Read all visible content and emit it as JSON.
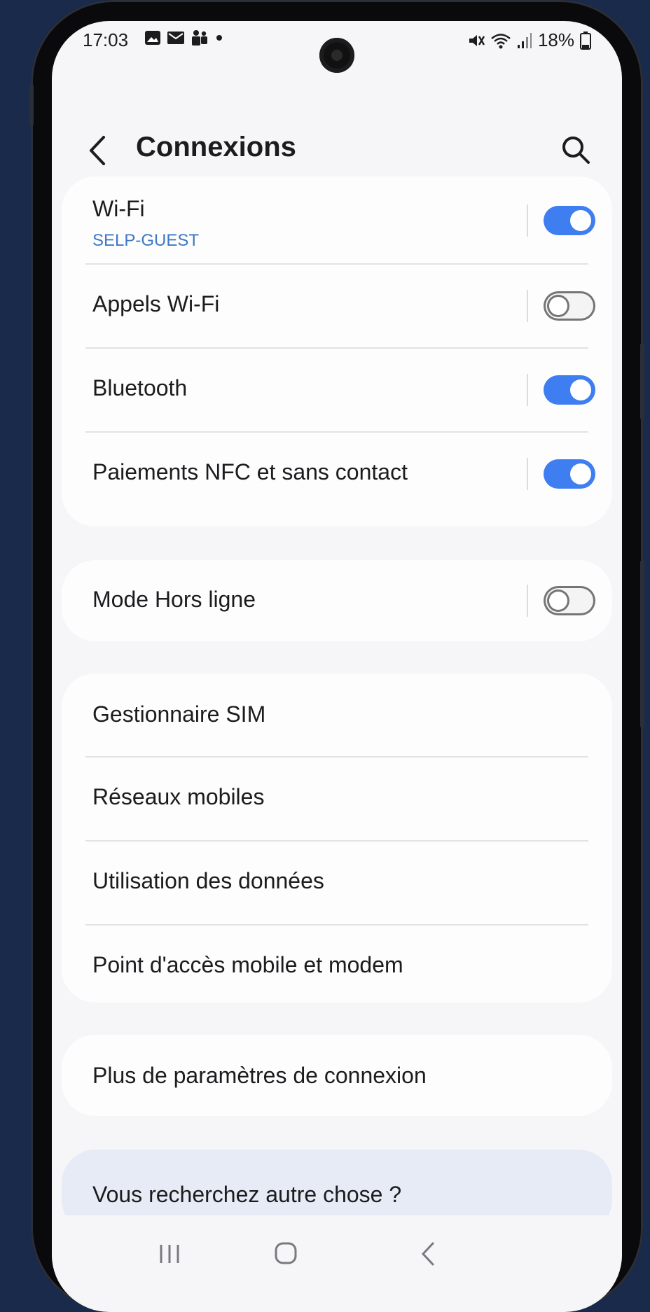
{
  "status": {
    "time": "17:03",
    "battery": "18%",
    "left_icons": [
      "image-icon",
      "mail-icon",
      "teams-icon",
      "dot-icon"
    ],
    "right_icons": [
      "mute-icon",
      "wifi-icon",
      "signal-icon",
      "battery-icon"
    ]
  },
  "header": {
    "title": "Connexions"
  },
  "sections": {
    "main": [
      {
        "label": "Wi-Fi",
        "sub": "SELP-GUEST",
        "toggle": "on"
      },
      {
        "label": "Appels Wi-Fi",
        "toggle": "off"
      },
      {
        "label": "Bluetooth",
        "toggle": "on"
      },
      {
        "label": "Paiements NFC et sans contact",
        "toggle": "on"
      }
    ],
    "airplane": {
      "label": "Mode Hors ligne",
      "toggle": "off"
    },
    "network": [
      {
        "label": "Gestionnaire SIM"
      },
      {
        "label": "Réseaux mobiles"
      },
      {
        "label": "Utilisation des données"
      },
      {
        "label": "Point d'accès mobile et modem"
      }
    ],
    "more": {
      "label": "Plus de paramètres de connexion"
    },
    "suggest": {
      "label": "Vous recherchez autre chose ?"
    }
  },
  "colors": {
    "accent": "#3f7ef0",
    "subtitle": "#3f78c4",
    "toggle_off": "#757575"
  }
}
